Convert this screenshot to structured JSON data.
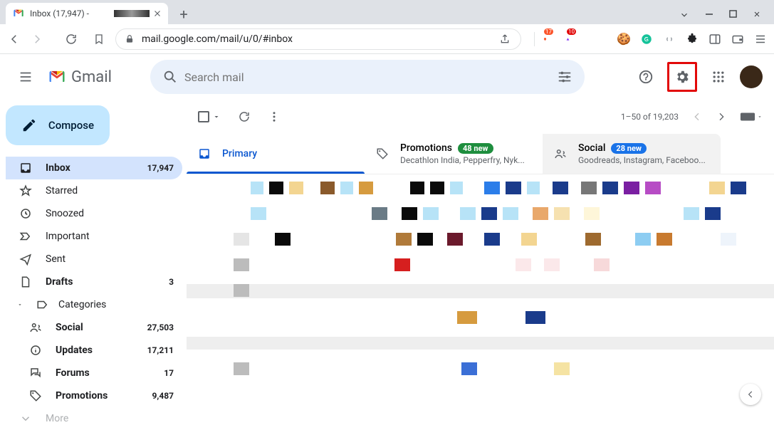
{
  "browser": {
    "tab_title": "Inbox (17,947) - ",
    "url": "mail.google.com/mail/u/0/#inbox"
  },
  "header": {
    "logo_text": "Gmail",
    "search_placeholder": "Search mail"
  },
  "compose_label": "Compose",
  "sidebar": {
    "items": [
      {
        "label": "Inbox",
        "count": "17,947",
        "selected": true,
        "bold": true
      },
      {
        "label": "Starred",
        "count": ""
      },
      {
        "label": "Snoozed",
        "count": ""
      },
      {
        "label": "Important",
        "count": ""
      },
      {
        "label": "Sent",
        "count": ""
      },
      {
        "label": "Drafts",
        "count": "3",
        "bold": true
      },
      {
        "label": "Categories",
        "count": "",
        "expandable": true
      }
    ],
    "categories": [
      {
        "label": "Social",
        "count": "27,503"
      },
      {
        "label": "Updates",
        "count": "17,211"
      },
      {
        "label": "Forums",
        "count": "17"
      },
      {
        "label": "Promotions",
        "count": "9,487"
      }
    ],
    "more_label": "More"
  },
  "toolbar": {
    "range": "1–50 of 19,203"
  },
  "tabs": {
    "primary": {
      "label": "Primary"
    },
    "promotions": {
      "label": "Promotions",
      "badge": "48 new",
      "sub": "Decathlon India, Pepperfry, Nyk..."
    },
    "social": {
      "label": "Social",
      "badge": "28 new",
      "sub": "Goodreads, Instagram, Faceboo..."
    }
  }
}
